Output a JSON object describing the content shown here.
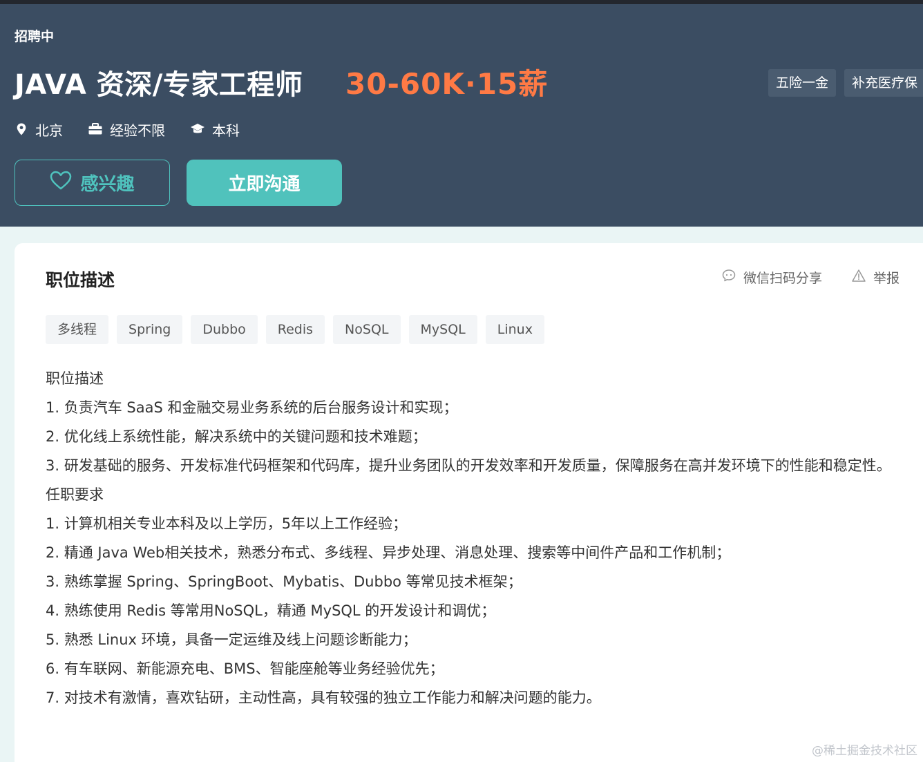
{
  "header": {
    "status": "招聘中",
    "job_title": "JAVA 资深/专家工程师",
    "salary": "30-60K·15薪",
    "benefits": [
      "五险一金",
      "补充医疗保"
    ],
    "meta": {
      "location": "北京",
      "experience": "经验不限",
      "education": "本科"
    },
    "buttons": {
      "interest": "感兴趣",
      "chat": "立即沟通"
    }
  },
  "card": {
    "section_title": "职位描述",
    "actions": {
      "share": "微信扫码分享",
      "report": "举报"
    },
    "tags": [
      "多线程",
      "Spring",
      "Dubbo",
      "Redis",
      "NoSQL",
      "MySQL",
      "Linux"
    ],
    "description": [
      "职位描述",
      "1. 负责汽车 SaaS 和金融交易业务系统的后台服务设计和实现；",
      "2. 优化线上系统性能，解决系统中的关键问题和技术难题；",
      "3. 研发基础的服务、开发标准代码框架和代码库，提升业务团队的开发效率和开发质量，保障服务在高并发环境下的性能和稳定性。",
      "任职要求",
      "1. 计算机相关专业本科及以上学历，5年以上工作经验；",
      "2. 精通 Java Web相关技术，熟悉分布式、多线程、异步处理、消息处理、搜索等中间件产品和工作机制；",
      "3. 熟练掌握 Spring、SpringBoot、Mybatis、Dubbo 等常见技术框架；",
      "4. 熟练使用 Redis 等常用NoSQL，精通 MySQL 的开发设计和调优；",
      "5. 熟悉 Linux 环境，具备一定运维及线上问题诊断能力；",
      "6. 有车联网、新能源充电、BMS、智能座舱等业务经验优先；",
      "7. 对技术有激情，喜欢钻研，主动性高，具有较强的独立工作能力和解决问题的能力。"
    ]
  },
  "watermark": "@稀土掘金技术社区",
  "colors": {
    "header_bg": "#3b4d62",
    "salary": "#ff7a45",
    "accent": "#50c2bc"
  },
  "icons": [
    "location-pin-icon",
    "briefcase-icon",
    "graduation-cap-icon",
    "heart-icon",
    "chat-bubble-icon",
    "warning-triangle-icon"
  ]
}
